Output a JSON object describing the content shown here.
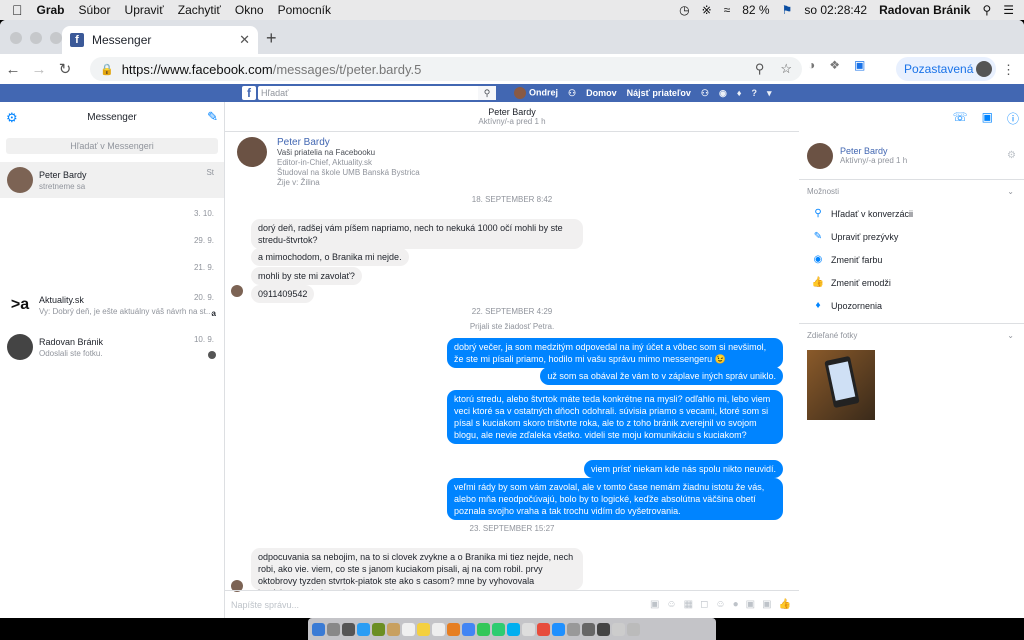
{
  "menubar": {
    "app": "Grab",
    "items": [
      "Súbor",
      "Upraviť",
      "Zachytiť",
      "Okno",
      "Pomocník"
    ],
    "battery": "82 %",
    "clock": "so 02:28:42",
    "user": "Radovan Bránik"
  },
  "browser": {
    "tab_title": "Messenger",
    "url_host": "https://www.facebook.com",
    "url_path": "/messages/t/peter.bardy.5",
    "paused_label": "Pozastavená"
  },
  "fb": {
    "search_placeholder": "Hľadať",
    "nav": [
      "Ondrej",
      "Domov",
      "Nájsť priateľov"
    ]
  },
  "left": {
    "title": "Messenger",
    "search_placeholder": "Hľadať v Messengeri",
    "threads": [
      {
        "name": "Peter Bardy",
        "preview": "stretneme sa",
        "date": "St"
      },
      {
        "date": "3. 10."
      },
      {
        "date": "29. 9."
      },
      {
        "date": "21. 9."
      },
      {
        "name": "Aktuality.sk",
        "preview": "Vy: Dobrý deň, je ešte aktuálny váš návrh na st...",
        "date": "20. 9."
      },
      {
        "name": "Radovan Bránik",
        "preview": "Odoslali ste fotku.",
        "date": "10. 9."
      }
    ]
  },
  "chat": {
    "name": "Peter Bardy",
    "status": "Aktívny/-a pred 1 h",
    "profile": {
      "name": "Peter Bardy",
      "line1": "Vaši priatelia na Facebooku",
      "line2": "Editor-in-Chief, Aktuality.sk",
      "line3": "Študoval na škole UMB Banská Bystrica",
      "line4": "Žije v: Žilina"
    },
    "ts1": "18. SEPTEMBER 8:42",
    "ts2": "22. SEPTEMBER 4:29",
    "accepted": "Prijali ste žiadosť Petra.",
    "ts3": "23. SEPTEMBER 15:27",
    "m1": "dorý deň,  radšej vám píšem napriamo, nech to nekuká 1000 očí mohli by ste stredu-štvrtok?",
    "m2": "a mimochodom, o Branika mi nejde.",
    "m3": "mohli by ste mi zavolať?",
    "m4": "0911409542",
    "m5": "dobrý večer, ja som medzitým odpovedal na iný účet a vôbec som si nevšimol, že ste mi písali priamo, hodilo mi vašu správu mimo messengeru 😉",
    "m6": "už som sa obával že vám to v záplave iných správ uniklo.",
    "m7": "ktorú stredu, alebo štvrtok máte teda konkrétne na mysli? odľahlo mi, lebo viem veci ktoré sa v ostatných dňoch odohrali. súvisia priamo s vecami, ktoré som si písal s kuciakom skoro trištvrte roka, ale to z toho bránik zverejnil vo svojom blogu, ale nevie zďaleka všetko. videli ste moju komunikáciu s kuciakom?",
    "m8": "viem prísť niekam kde nás spolu nikto neuvidí.",
    "m9": "veľmi rády by som vám zavolal, ale v tomto čase nemám žiadnu istotu že vás, alebo mňa neodpočúvajú, bolo by to logické, keďže absolútna väčšina obetí poznala svojho vraha a tak trochu vidím do vyšetrovania.",
    "m10": "odpocuvania sa nebojim, na to si clovek zvykne a o Branika mi tiez nejde, nech robi, ako vie. viem, co ste s janom kuciakom pisali, aj na com robil. prvy oktobrovy tyzden stvrtok-piatok ste ako s casom? mne by vyhovovala bratislava, pokojne a bezpecne miesto mam",
    "compose_placeholder": "Napíšte správu..."
  },
  "right": {
    "name": "Peter Bardy",
    "status": "Aktívny/-a pred 1 h",
    "options_title": "Možnosti",
    "options": [
      "Hľadať v konverzácii",
      "Upraviť prezývky",
      "Zmeniť farbu",
      "Zmeniť emodži",
      "Upozornenia"
    ],
    "shared_title": "Zdieľané fotky"
  },
  "colors": {
    "fb_blue": "#4267b2",
    "messenger_blue": "#0084ff"
  }
}
